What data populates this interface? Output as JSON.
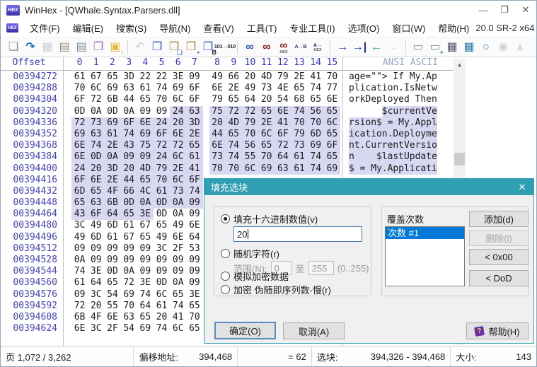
{
  "window": {
    "title": "WinHex - [QWhale.Syntax.Parsers.dll]",
    "version": "20.0 SR-2 x64",
    "logo_text": "HEX",
    "icons": {
      "minimize": "—",
      "maximize": "❐",
      "close": "✕",
      "mdi_minimize": "▬",
      "mdi_restore": "❐",
      "mdi_close": "✕",
      "scroll_up": "▲"
    }
  },
  "menu": {
    "items": [
      {
        "id": "file",
        "label": "文件(F)"
      },
      {
        "id": "edit",
        "label": "编辑(E)"
      },
      {
        "id": "search",
        "label": "搜索(S)"
      },
      {
        "id": "navigation",
        "label": "导航(N)"
      },
      {
        "id": "view",
        "label": "查看(V)"
      },
      {
        "id": "tools",
        "label": "工具(T)"
      },
      {
        "id": "specialist-tools",
        "label": "专业工具(I)"
      },
      {
        "id": "options",
        "label": "选项(O)"
      },
      {
        "id": "window",
        "label": "窗口(W)"
      },
      {
        "id": "help",
        "label": "帮助(H)"
      }
    ]
  },
  "toolbar": {
    "items": [
      {
        "name": "new-file-icon",
        "glyph": "❏",
        "color": "#8a8a8a"
      },
      {
        "name": "open-file-icon",
        "glyph": "↷",
        "color": "#1f6fc4",
        "bold": true
      },
      {
        "name": "save-icon",
        "glyph": "▦",
        "color": "#c0c0c0",
        "disabled": true
      },
      {
        "name": "print-preview-icon",
        "glyph": "▤",
        "color": "#9a8f7a"
      },
      {
        "name": "print-icon",
        "glyph": "▤",
        "color": "#7a8a9a"
      },
      {
        "name": "properties-icon",
        "glyph": "❒",
        "color": "#8a6aaa"
      },
      {
        "name": "folder-up-icon",
        "glyph": "▣",
        "color": "#e6b83c",
        "overlay": "↑",
        "overlay_color": "#1faa1f"
      },
      {
        "sep": true
      },
      {
        "name": "undo-icon",
        "glyph": "↶",
        "color": "#c0c0c0",
        "disabled": true
      },
      {
        "name": "copy-block-icon",
        "glyph": "❐",
        "color": "#2a52c8"
      },
      {
        "name": "paste-clipboard-icon",
        "glyph": "❒",
        "color": "#b08040",
        "overlay": "❏",
        "overlay_color": "#2a52c8"
      },
      {
        "name": "write-clipboard-icon",
        "glyph": "❒",
        "color": "#b08040",
        "overlay": "▪",
        "overlay_color": "#2a52c8"
      },
      {
        "name": "copy-hex-icon",
        "glyph": "❐",
        "color": "#2a52c8",
        "overlay": "B",
        "overlay_color": "#202020"
      },
      {
        "name": "binary-conversion-icon",
        "glyph": "101→010",
        "color": "#202020",
        "small": true
      },
      {
        "sep": true
      },
      {
        "name": "find-text-icon",
        "glyph": "∞",
        "color": "#2a4fd0",
        "bold": true
      },
      {
        "name": "find-again-icon",
        "glyph": "∞",
        "color": "#8a1a1a",
        "bold": true
      },
      {
        "name": "find-hex-icon",
        "glyph": "∞",
        "color": "#8a1a1a",
        "bold": true,
        "sub": "HEX"
      },
      {
        "name": "replace-text-icon",
        "glyph": "A→B",
        "color": "#203080",
        "small": true
      },
      {
        "name": "replace-hex-icon",
        "glyph": "A→",
        "color": "#203080",
        "small": true,
        "sub": "HEX"
      },
      {
        "sep": true
      },
      {
        "name": "goto-offset-icon",
        "glyph": "→",
        "color": "#20309a",
        "bold": true
      },
      {
        "name": "goto-block-end-icon",
        "glyph": "→|",
        "color": "#20309a",
        "bold": true
      },
      {
        "name": "back-icon",
        "glyph": "←",
        "color": "#2a8a9a",
        "bold": true
      },
      {
        "name": "forward-icon",
        "glyph": "→",
        "color": "#bcdde4",
        "bold": true,
        "disabled": true
      },
      {
        "sep": true
      },
      {
        "name": "open-disk-icon",
        "glyph": "▭",
        "color": "#8a8a8a"
      },
      {
        "name": "disk-tools-icon",
        "glyph": "▭",
        "color": "#8a8a8a",
        "overlay": "+",
        "overlay_color": "#1faa1f"
      },
      {
        "name": "open-ram-icon",
        "glyph": "▦",
        "color": "#55556a"
      },
      {
        "name": "calculator-icon",
        "glyph": "▦",
        "color": "#2a7fae"
      },
      {
        "name": "magnifier-icon",
        "glyph": "○",
        "color": "#3a7ac0",
        "bold": true
      },
      {
        "name": "camera-icon",
        "glyph": "◉",
        "color": "#c4c4c4",
        "disabled": true
      },
      {
        "name": "overflow-icon",
        "glyph": "▲",
        "color": "#cfe0ea"
      }
    ]
  },
  "hex": {
    "header": {
      "offset_label": "Offset",
      "cols": [
        "0",
        "1",
        "2",
        "3",
        "4",
        "5",
        "6",
        "7",
        "8",
        "9",
        "10",
        "11",
        "12",
        "13",
        "14",
        "15"
      ],
      "ansi_label": "ANSI ASCII"
    },
    "rows": [
      {
        "offset": "00394272",
        "bytes": [
          "61",
          "67",
          "65",
          "3D",
          "22",
          "22",
          "3E",
          "09",
          "49",
          "66",
          "20",
          "4D",
          "79",
          "2E",
          "41",
          "70"
        ],
        "ansi": "age=\"\"> If My.Ap",
        "hl": null,
        "ansi_hl": null
      },
      {
        "offset": "00394288",
        "bytes": [
          "70",
          "6C",
          "69",
          "63",
          "61",
          "74",
          "69",
          "6F",
          "6E",
          "2E",
          "49",
          "73",
          "4E",
          "65",
          "74",
          "77"
        ],
        "ansi": "plication.IsNetw",
        "hl": null,
        "ansi_hl": null
      },
      {
        "offset": "00394304",
        "bytes": [
          "6F",
          "72",
          "6B",
          "44",
          "65",
          "70",
          "6C",
          "6F",
          "79",
          "65",
          "64",
          "20",
          "54",
          "68",
          "65",
          "6E"
        ],
        "ansi": "orkDeployed Then",
        "hl": null,
        "ansi_hl": null
      },
      {
        "offset": "00394320",
        "bytes": [
          "0D",
          "0A",
          "0D",
          "0A",
          "09",
          "09",
          "24",
          "63",
          "75",
          "72",
          "72",
          "65",
          "6E",
          "74",
          "56",
          "65"
        ],
        "ansi": "      $currentVe",
        "hl": [
          6,
          15
        ],
        "ansi_hl": [
          6,
          15
        ]
      },
      {
        "offset": "00394336",
        "bytes": [
          "72",
          "73",
          "69",
          "6F",
          "6E",
          "24",
          "20",
          "3D",
          "20",
          "4D",
          "79",
          "2E",
          "41",
          "70",
          "70",
          "6C"
        ],
        "ansi": "rsion$ = My.Appl",
        "hl": [
          0,
          15
        ],
        "ansi_hl": [
          0,
          15
        ]
      },
      {
        "offset": "00394352",
        "bytes": [
          "69",
          "63",
          "61",
          "74",
          "69",
          "6F",
          "6E",
          "2E",
          "44",
          "65",
          "70",
          "6C",
          "6F",
          "79",
          "6D",
          "65"
        ],
        "ansi": "ication.Deployme",
        "hl": [
          0,
          15
        ],
        "ansi_hl": [
          0,
          15
        ]
      },
      {
        "offset": "00394368",
        "bytes": [
          "6E",
          "74",
          "2E",
          "43",
          "75",
          "72",
          "72",
          "65",
          "6E",
          "74",
          "56",
          "65",
          "72",
          "73",
          "69",
          "6F"
        ],
        "ansi": "nt.CurrentVersio",
        "hl": [
          0,
          15
        ],
        "ansi_hl": [
          0,
          15
        ]
      },
      {
        "offset": "00394384",
        "bytes": [
          "6E",
          "0D",
          "0A",
          "09",
          "09",
          "24",
          "6C",
          "61",
          "73",
          "74",
          "55",
          "70",
          "64",
          "61",
          "74",
          "65"
        ],
        "ansi": "n    $lastUpdate",
        "hl": [
          0,
          15
        ],
        "ansi_hl": [
          0,
          15
        ]
      },
      {
        "offset": "00394400",
        "bytes": [
          "24",
          "20",
          "3D",
          "20",
          "4D",
          "79",
          "2E",
          "41",
          "70",
          "70",
          "6C",
          "69",
          "63",
          "61",
          "74",
          "69"
        ],
        "ansi": "$ = My.Applicati",
        "hl": [
          0,
          15
        ],
        "ansi_hl": [
          0,
          15
        ]
      },
      {
        "offset": "00394416",
        "bytes": [
          "6F",
          "6E",
          "2E",
          "44",
          "65",
          "70",
          "6C",
          "6F"
        ],
        "ansi": "",
        "hl": [
          0,
          7
        ],
        "ansi_hl": null
      },
      {
        "offset": "00394432",
        "bytes": [
          "6D",
          "65",
          "4F",
          "66",
          "4C",
          "61",
          "73",
          "74"
        ],
        "ansi": "",
        "hl": [
          0,
          7
        ],
        "ansi_hl": null
      },
      {
        "offset": "00394448",
        "bytes": [
          "65",
          "63",
          "6B",
          "0D",
          "0A",
          "0D",
          "0A",
          "09"
        ],
        "ansi": "",
        "hl": [
          0,
          7
        ],
        "ansi_hl": null
      },
      {
        "offset": "00394464",
        "bytes": [
          "43",
          "6F",
          "64",
          "65",
          "3E",
          "0D",
          "0A",
          "09"
        ],
        "ansi": "",
        "hl": [
          0,
          4
        ],
        "ansi_hl": null
      },
      {
        "offset": "00394480",
        "bytes": [
          "3C",
          "49",
          "6D",
          "61",
          "67",
          "65",
          "49",
          "6E"
        ],
        "ansi": "",
        "hl": null,
        "ansi_hl": null
      },
      {
        "offset": "00394496",
        "bytes": [
          "49",
          "6D",
          "61",
          "67",
          "65",
          "49",
          "6E",
          "64"
        ],
        "ansi": "",
        "hl": null,
        "ansi_hl": null
      },
      {
        "offset": "00394512",
        "bytes": [
          "09",
          "09",
          "09",
          "09",
          "09",
          "3C",
          "2F",
          "53"
        ],
        "ansi": "",
        "hl": null,
        "ansi_hl": null
      },
      {
        "offset": "00394528",
        "bytes": [
          "0A",
          "09",
          "09",
          "09",
          "09",
          "09",
          "09",
          "09"
        ],
        "ansi": "",
        "hl": null,
        "ansi_hl": null
      },
      {
        "offset": "00394544",
        "bytes": [
          "74",
          "3E",
          "0D",
          "0A",
          "09",
          "09",
          "09",
          "09"
        ],
        "ansi": "",
        "hl": null,
        "ansi_hl": null
      },
      {
        "offset": "00394560",
        "bytes": [
          "61",
          "64",
          "65",
          "72",
          "3E",
          "0D",
          "0A",
          "09"
        ],
        "ansi": "",
        "hl": null,
        "ansi_hl": null
      },
      {
        "offset": "00394576",
        "bytes": [
          "09",
          "3C",
          "54",
          "69",
          "74",
          "6C",
          "65",
          "3E"
        ],
        "ansi": "",
        "hl": null,
        "ansi_hl": null
      },
      {
        "offset": "00394592",
        "bytes": [
          "72",
          "20",
          "55",
          "70",
          "64",
          "61",
          "74",
          "65"
        ],
        "ansi": "",
        "hl": null,
        "ansi_hl": null
      },
      {
        "offset": "00394608",
        "bytes": [
          "6B",
          "4F",
          "6E",
          "63",
          "65",
          "20",
          "41",
          "70"
        ],
        "ansi": "",
        "hl": null,
        "ansi_hl": null
      },
      {
        "offset": "00394624",
        "bytes": [
          "6E",
          "3C",
          "2F",
          "54",
          "69",
          "74",
          "6C",
          "65"
        ],
        "ansi": "",
        "hl": null,
        "ansi_hl": null
      }
    ]
  },
  "dialog": {
    "title": "填充选块",
    "radio_hex_label": "填充十六进制数值(v)",
    "hex_value": "20",
    "radio_random_label": "随机字符(r)",
    "range_label": "范围(N):",
    "range_from": "0",
    "range_to_word": "至",
    "range_to": "255",
    "range_hint": "(0..255)",
    "radio_simulate_label": "模拟加密数据",
    "radio_encrypt_label": "加密 伪随即序列数-慢(r)",
    "overwrite_label": "覆盖次数",
    "list": {
      "items": [
        "次数 #1"
      ],
      "selected_index": 0
    },
    "buttons": {
      "add": "添加(d)",
      "delete": "删除(l)",
      "zero": "< 0x00",
      "dod": "< DoD",
      "ok": "确定(O)",
      "cancel": "取消(A)",
      "help": "帮助(H)"
    },
    "help_icon_glyph": "?"
  },
  "status": {
    "page": "页 1,072 / 3,262",
    "offset_label": "偏移地址:",
    "offset_value": "394,468",
    "equals": "= 62",
    "block_label": "选块:",
    "block_value": "394,326 - 394,468",
    "size_label": "大小:",
    "size_value": "143"
  }
}
